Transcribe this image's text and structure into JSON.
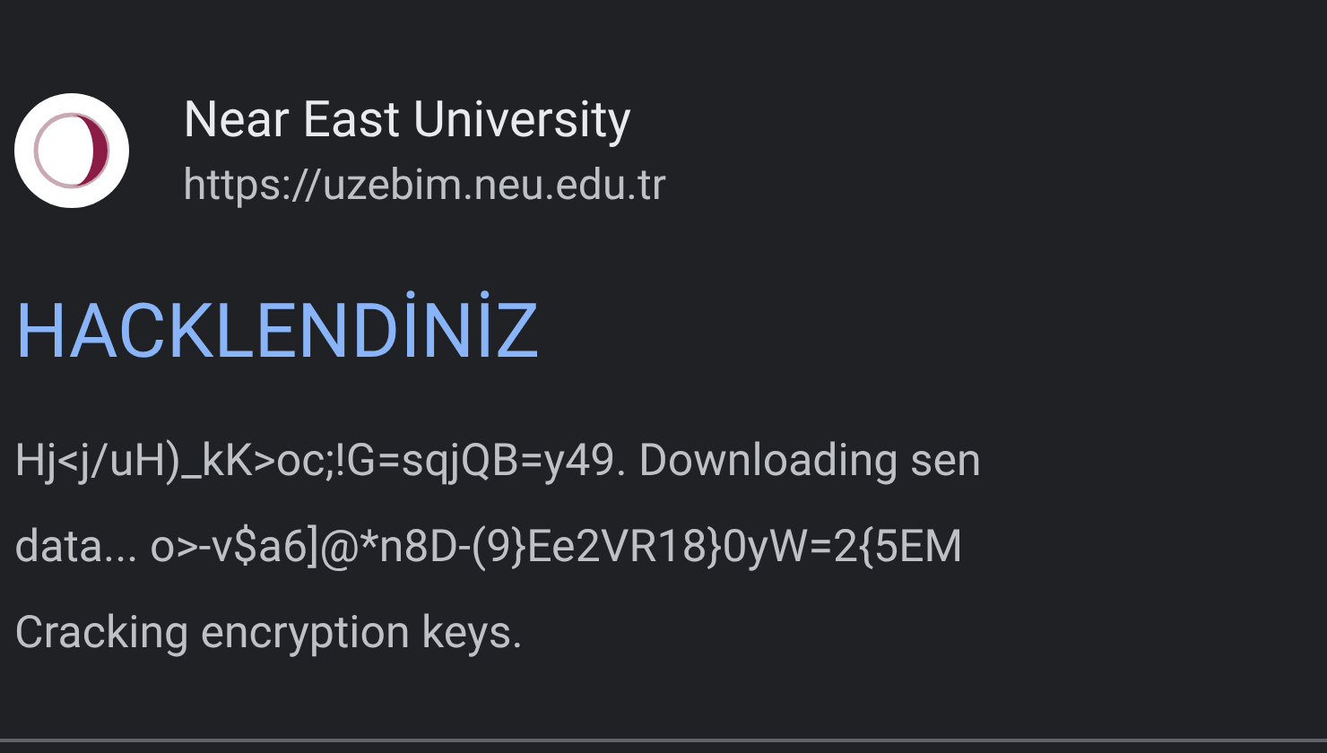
{
  "site": {
    "name": "Near East University",
    "url": "https://uzebim.neu.edu.tr"
  },
  "title": "HACKLENDİNİZ",
  "snippet_lines": [
    "Hj<j/uH)_kK>oc;!G=sqjQB=y49. Downloading sen",
    "data... o>-v$a6]@*n8D-(9}Ee2VR18}0yW=2{5EM",
    "Cracking encryption keys."
  ]
}
